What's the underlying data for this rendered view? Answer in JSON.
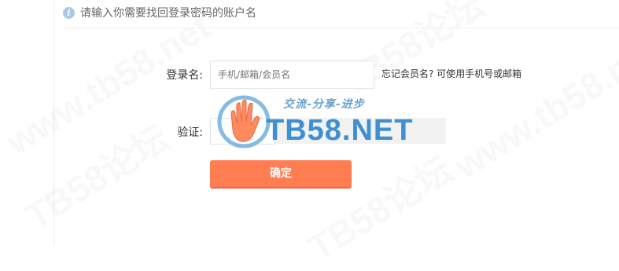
{
  "notice": {
    "icon": "info-icon",
    "text": "请输入你需要找回登录密码的账户名"
  },
  "form": {
    "login_name": {
      "label": "登录名:",
      "placeholder": "手机/邮箱/会员名"
    },
    "login_hint": "忘记会员名? 可使用手机号或邮箱",
    "verify": {
      "label": "验证:"
    },
    "submit_label": "确定"
  },
  "watermark": {
    "slogan": "交流-分享-进步",
    "wordmark": "TB58.NET",
    "tiles": [
      "TB58论坛",
      "www.tb58.net"
    ]
  },
  "colors": {
    "accent": "#ff7d51",
    "logo_blue": "#3f8fd3",
    "info_icon": "#a9c9e7"
  }
}
